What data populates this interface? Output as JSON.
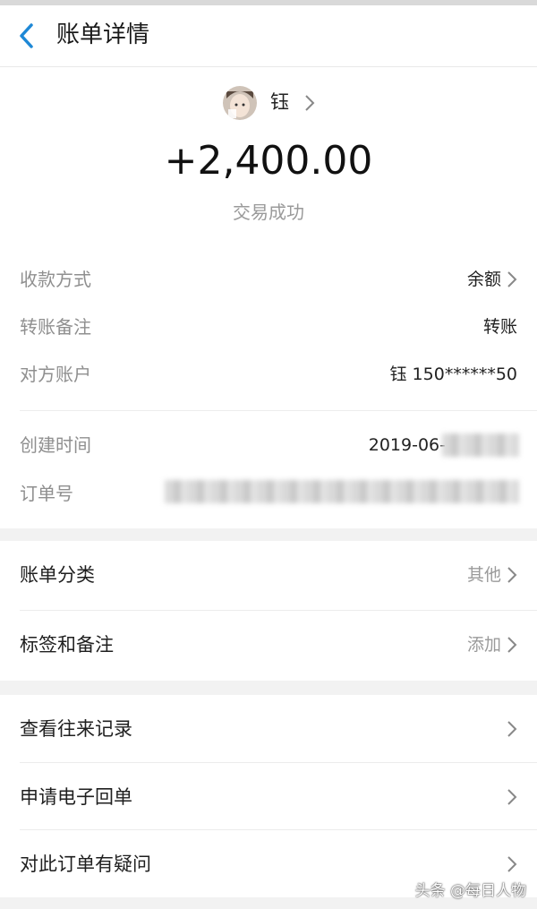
{
  "nav": {
    "title": "账单详情"
  },
  "payer": {
    "name": "钰"
  },
  "transaction": {
    "amount": "+2,400.00",
    "status": "交易成功"
  },
  "details": [
    {
      "label": "收款方式",
      "value": "余额"
    },
    {
      "label": "转账备注",
      "value": "转账"
    },
    {
      "label": "对方账户",
      "value": "钰 150******50"
    }
  ],
  "meta": {
    "created_label": "创建时间",
    "created_value": "2019-06-",
    "order_label": "订单号"
  },
  "category": {
    "label": "账单分类",
    "value": "其他"
  },
  "tags": {
    "label": "标签和备注",
    "value": "添加"
  },
  "actions": [
    {
      "label": "查看往来记录"
    },
    {
      "label": "申请电子回单"
    },
    {
      "label": "对此订单有疑问"
    }
  ],
  "watermark": "头条 @每日人物"
}
